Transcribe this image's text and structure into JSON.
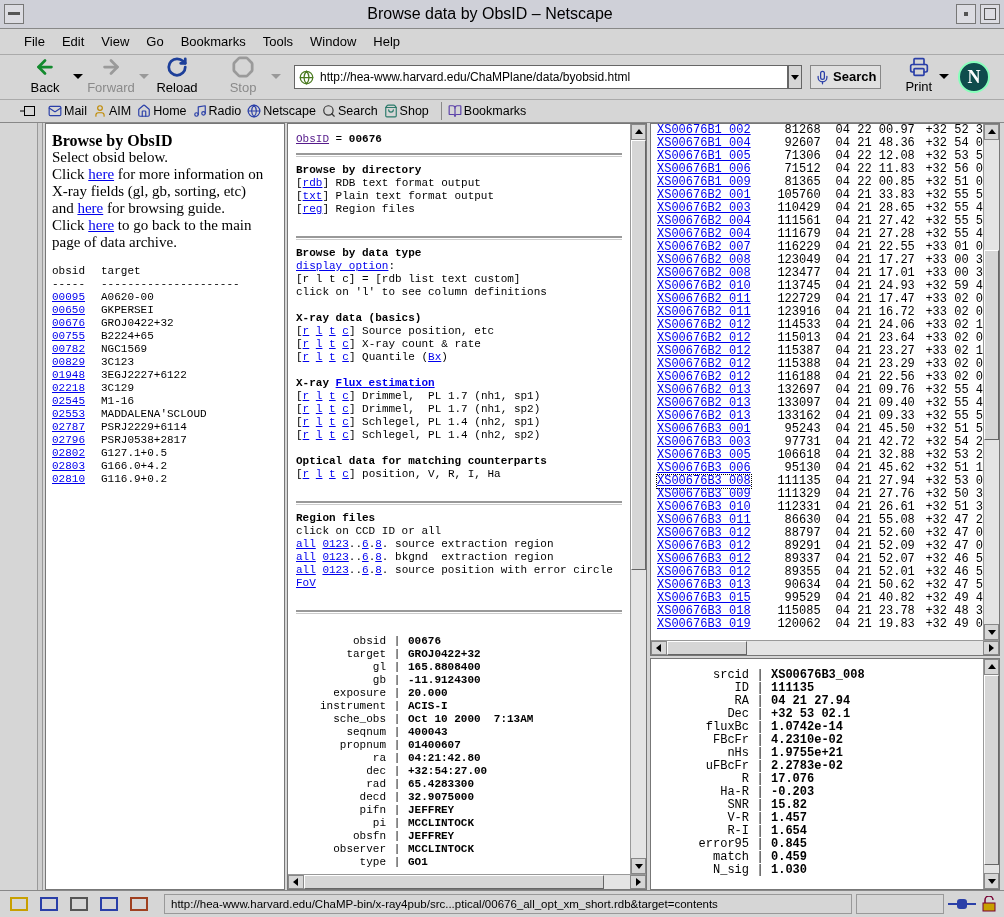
{
  "window": {
    "title": "Browse data by ObsID – Netscape"
  },
  "menu": [
    "File",
    "Edit",
    "View",
    "Go",
    "Bookmarks",
    "Tools",
    "Window",
    "Help"
  ],
  "nav_toolbar": {
    "buttons": [
      {
        "label": "Back",
        "kind": "back",
        "disabled": false,
        "dropdown": true
      },
      {
        "label": "Forward",
        "kind": "forward",
        "disabled": true,
        "dropdown": true
      },
      {
        "label": "Reload",
        "kind": "reload",
        "disabled": false,
        "dropdown": false
      },
      {
        "label": "Stop",
        "kind": "stop",
        "disabled": true,
        "dropdown": true
      }
    ],
    "url": "http://hea-www.harvard.edu/ChaMPlane/data/byobsid.html",
    "search": "Search",
    "print": "Print",
    "logo_letter": "N"
  },
  "personal_toolbar": [
    {
      "label": "Mail",
      "kind": "mail"
    },
    {
      "label": "AIM",
      "kind": "aim"
    },
    {
      "label": "Home",
      "kind": "home"
    },
    {
      "label": "Radio",
      "kind": "radio"
    },
    {
      "label": "Netscape",
      "kind": "netscape"
    },
    {
      "label": "Search",
      "kind": "search"
    },
    {
      "label": "Shop",
      "kind": "shop"
    },
    {
      "label": "Bookmarks",
      "kind": "bookmarks"
    }
  ],
  "left_frame": {
    "heading": "Browse by ObsID",
    "paragraphs": [
      [
        {
          "t": "Select obsid below."
        }
      ],
      [
        {
          "t": "Click "
        },
        {
          "t": "here",
          "link": true
        },
        {
          "t": " for more information on X-ray fields (gl, gb, sorting, etc) and "
        },
        {
          "t": "here",
          "link": true
        },
        {
          "t": " for browsing guide."
        }
      ],
      [
        {
          "t": "Click "
        },
        {
          "t": "here",
          "link": true
        },
        {
          "t": " to go back to the main page of data archive."
        }
      ]
    ],
    "table": {
      "columns": [
        "obsid",
        "target"
      ],
      "rules": [
        "-----",
        "---------------------"
      ],
      "rows": [
        {
          "obsid": "00095",
          "target": "A0620-00"
        },
        {
          "obsid": "00650",
          "target": "GKPERSEI"
        },
        {
          "obsid": "00676",
          "target": "GROJ0422+32"
        },
        {
          "obsid": "00755",
          "target": "B2224+65"
        },
        {
          "obsid": "00782",
          "target": "NGC1569"
        },
        {
          "obsid": "00829",
          "target": "3C123"
        },
        {
          "obsid": "01948",
          "target": "3EGJ2227+6122"
        },
        {
          "obsid": "02218",
          "target": "3C129"
        },
        {
          "obsid": "02545",
          "target": "M1-16"
        },
        {
          "obsid": "02553",
          "target": "MADDALENA'SCLOUD"
        },
        {
          "obsid": "02787",
          "target": "PSRJ2229+6114"
        },
        {
          "obsid": "02796",
          "target": "PSRJ0538+2817"
        },
        {
          "obsid": "02802",
          "target": "G127.1+0.5"
        },
        {
          "obsid": "02803",
          "target": "G166.0+4.2"
        },
        {
          "obsid": "02810",
          "target": "G116.9+0.2"
        }
      ]
    }
  },
  "middle_frame": {
    "top": [
      {
        "t": "ObsID",
        "link": true,
        "visited": true
      },
      {
        "t": " = "
      },
      {
        "t": "00676",
        "bold": true
      }
    ],
    "groups": [
      {
        "sections": [
          {
            "heading": [
              {
                "t": "Browse by directory"
              }
            ],
            "lines": [
              [
                {
                  "t": "["
                },
                {
                  "t": "rdb",
                  "link": true
                },
                {
                  "t": "] RDB text format output"
                }
              ],
              [
                {
                  "t": "["
                },
                {
                  "t": "txt",
                  "link": true
                },
                {
                  "t": "] Plain text format output"
                }
              ],
              [
                {
                  "t": "["
                },
                {
                  "t": "reg",
                  "link": true
                },
                {
                  "t": "] Region files"
                }
              ]
            ]
          }
        ]
      },
      {
        "sections": [
          {
            "heading": [
              {
                "t": "Browse by data type"
              }
            ],
            "lines": [
              [
                {
                  "t": "display option",
                  "link": true
                },
                {
                  "t": ":"
                }
              ],
              [
                {
                  "t": "[r l t c] = [rdb list text custom]"
                }
              ],
              [
                {
                  "t": "click on 'l' to see column definitions"
                }
              ]
            ]
          },
          {
            "heading": [
              {
                "t": "X-ray data (basics)"
              }
            ],
            "lines": [
              [
                {
                  "t": "["
                },
                {
                  "t": "r",
                  "link": true
                },
                {
                  "t": "l",
                  "link": true
                },
                {
                  "t": "t",
                  "link": true
                },
                {
                  "t": "c",
                  "link": true
                },
                {
                  "t": "] Source position, etc"
                }
              ],
              [
                {
                  "t": "["
                },
                {
                  "t": "r",
                  "link": true
                },
                {
                  "t": "l",
                  "link": true
                },
                {
                  "t": "t",
                  "link": true
                },
                {
                  "t": "c",
                  "link": true
                },
                {
                  "t": "] X-ray count & rate"
                }
              ],
              [
                {
                  "t": "["
                },
                {
                  "t": "r",
                  "link": true
                },
                {
                  "t": "l",
                  "link": true
                },
                {
                  "t": "t",
                  "link": true
                },
                {
                  "t": "c",
                  "link": true
                },
                {
                  "t": "] Quantile ("
                },
                {
                  "t": "Bx",
                  "link": true
                },
                {
                  "t": ")"
                }
              ]
            ]
          },
          {
            "heading": [
              {
                "t": "X-ray "
              },
              {
                "t": "Flux estimation",
                "link": true
              }
            ],
            "lines": [
              [
                {
                  "t": "["
                },
                {
                  "t": "r",
                  "link": true
                },
                {
                  "t": "l",
                  "link": true
                },
                {
                  "t": "t",
                  "link": true
                },
                {
                  "t": "c",
                  "link": true
                },
                {
                  "t": "] Drimmel,  PL 1.7 (nh1, sp1)"
                }
              ],
              [
                {
                  "t": "["
                },
                {
                  "t": "r",
                  "link": true
                },
                {
                  "t": "l",
                  "link": true
                },
                {
                  "t": "t",
                  "link": true
                },
                {
                  "t": "c",
                  "link": true
                },
                {
                  "t": "] Drimmel,  PL 1.7 (nh1, sp2)"
                }
              ],
              [
                {
                  "t": "["
                },
                {
                  "t": "r",
                  "link": true
                },
                {
                  "t": "l",
                  "link": true
                },
                {
                  "t": "t",
                  "link": true
                },
                {
                  "t": "c",
                  "link": true
                },
                {
                  "t": "] Schlegel, PL 1.4 (nh2, sp1)"
                }
              ],
              [
                {
                  "t": "["
                },
                {
                  "t": "r",
                  "link": true
                },
                {
                  "t": "l",
                  "link": true
                },
                {
                  "t": "t",
                  "link": true
                },
                {
                  "t": "c",
                  "link": true
                },
                {
                  "t": "] Schlegel, PL 1.4 (nh2, sp2)"
                }
              ]
            ]
          },
          {
            "heading": [
              {
                "t": "Optical data for matching counterparts"
              }
            ],
            "lines": [
              [
                {
                  "t": "["
                },
                {
                  "t": "r",
                  "link": true
                },
                {
                  "t": "l",
                  "link": true
                },
                {
                  "t": "t",
                  "link": true
                },
                {
                  "t": "c",
                  "link": true
                },
                {
                  "t": "] position, V, R, I, Ha"
                }
              ]
            ]
          }
        ]
      },
      {
        "sections": [
          {
            "heading": [
              {
                "t": "Region files"
              }
            ],
            "lines": [
              [
                {
                  "t": "click on CCD ID or all"
                }
              ],
              [
                {
                  "t": "all",
                  "link": true
                },
                {
                  "t": "0123",
                  "link": true
                },
                {
                  "t": ".."
                },
                {
                  "t": "6",
                  "link": true
                },
                {
                  "t": "."
                },
                {
                  "t": "8",
                  "link": true
                },
                {
                  "t": ". source extraction region"
                }
              ],
              [
                {
                  "t": "all",
                  "link": true
                },
                {
                  "t": "0123",
                  "link": true
                },
                {
                  "t": ".."
                },
                {
                  "t": "6",
                  "link": true
                },
                {
                  "t": "."
                },
                {
                  "t": "8",
                  "link": true
                },
                {
                  "t": ". bkgnd  extraction region"
                }
              ],
              [
                {
                  "t": "all",
                  "link": true
                },
                {
                  "t": "0123",
                  "link": true
                },
                {
                  "t": ".."
                },
                {
                  "t": "6",
                  "link": true
                },
                {
                  "t": "."
                },
                {
                  "t": "8",
                  "link": true
                },
                {
                  "t": ". source position with error circle"
                }
              ],
              [
                {
                  "t": "FoV",
                  "link": true
                }
              ]
            ]
          }
        ]
      }
    ],
    "info": [
      {
        "label": "obsid",
        "value": "00676"
      },
      {
        "label": "target",
        "value": "GROJ0422+32"
      },
      {
        "label": "gl",
        "value": "165.8808400"
      },
      {
        "label": "gb",
        "value": "-11.9124300"
      },
      {
        "label": "exposure",
        "value": "20.000"
      },
      {
        "label": "instrument",
        "value": "ACIS-I"
      },
      {
        "label": "sche_obs",
        "value": "Oct 10 2000  7:13AM"
      },
      {
        "label": "seqnum",
        "value": "400043"
      },
      {
        "label": "propnum",
        "value": "01400607"
      },
      {
        "label": "ra",
        "value": "04:21:42.80"
      },
      {
        "label": "dec",
        "value": "+32:54:27.00"
      },
      {
        "label": "rad",
        "value": "65.4283300"
      },
      {
        "label": "decd",
        "value": "32.9075000"
      },
      {
        "label": "pifn",
        "value": "JEFFREY"
      },
      {
        "label": "pi",
        "value": "MCCLINTOCK"
      },
      {
        "label": "obsfn",
        "value": "JEFFREY"
      },
      {
        "label": "observer",
        "value": "MCCLINTOCK"
      },
      {
        "label": "type",
        "value": "GO1"
      }
    ],
    "separator": "|"
  },
  "sources_frame": {
    "rows": [
      {
        "srcid": "XS00676B1_002",
        "id": "81268",
        "ra": "04 22 00.97",
        "dec": "+32 52 3",
        "focused": false
      },
      {
        "srcid": "XS00676B1_004",
        "id": "92607",
        "ra": "04 21 48.36",
        "dec": "+32 54 0",
        "focused": false
      },
      {
        "srcid": "XS00676B1_005",
        "id": "71306",
        "ra": "04 22 12.08",
        "dec": "+32 53 5",
        "focused": false
      },
      {
        "srcid": "XS00676B1_006",
        "id": "71512",
        "ra": "04 22 11.83",
        "dec": "+32 56 0",
        "focused": false
      },
      {
        "srcid": "XS00676B1_009",
        "id": "81365",
        "ra": "04 22 00.85",
        "dec": "+32 51 0",
        "focused": false
      },
      {
        "srcid": "XS00676B2_001",
        "id": "105760",
        "ra": "04 21 33.83",
        "dec": "+32 55 5",
        "focused": false
      },
      {
        "srcid": "XS00676B2_003",
        "id": "110429",
        "ra": "04 21 28.65",
        "dec": "+32 55 4",
        "focused": false
      },
      {
        "srcid": "XS00676B2_004",
        "id": "111561",
        "ra": "04 21 27.42",
        "dec": "+32 55 5",
        "focused": false
      },
      {
        "srcid": "XS00676B2_004",
        "id": "111679",
        "ra": "04 21 27.28",
        "dec": "+32 55 4",
        "focused": false
      },
      {
        "srcid": "XS00676B2_007",
        "id": "116229",
        "ra": "04 21 22.55",
        "dec": "+33 01 0",
        "focused": false
      },
      {
        "srcid": "XS00676B2_008",
        "id": "123049",
        "ra": "04 21 17.27",
        "dec": "+33 00 3",
        "focused": false
      },
      {
        "srcid": "XS00676B2_008",
        "id": "123477",
        "ra": "04 21 17.01",
        "dec": "+33 00 3",
        "focused": false
      },
      {
        "srcid": "XS00676B2_010",
        "id": "113745",
        "ra": "04 21 24.93",
        "dec": "+32 59 4",
        "focused": false
      },
      {
        "srcid": "XS00676B2_011",
        "id": "122729",
        "ra": "04 21 17.47",
        "dec": "+33 02 0",
        "focused": false
      },
      {
        "srcid": "XS00676B2_011",
        "id": "123916",
        "ra": "04 21 16.72",
        "dec": "+33 02 0",
        "focused": false
      },
      {
        "srcid": "XS00676B2_012",
        "id": "114533",
        "ra": "04 21 24.06",
        "dec": "+33 02 1",
        "focused": false
      },
      {
        "srcid": "XS00676B2_012",
        "id": "115013",
        "ra": "04 21 23.64",
        "dec": "+33 02 0",
        "focused": false
      },
      {
        "srcid": "XS00676B2_012",
        "id": "115387",
        "ra": "04 21 23.27",
        "dec": "+33 02 1",
        "focused": false
      },
      {
        "srcid": "XS00676B2_012",
        "id": "115388",
        "ra": "04 21 23.29",
        "dec": "+33 02 0",
        "focused": false
      },
      {
        "srcid": "XS00676B2_012",
        "id": "116188",
        "ra": "04 21 22.56",
        "dec": "+33 02 0",
        "focused": false
      },
      {
        "srcid": "XS00676B2_013",
        "id": "132697",
        "ra": "04 21 09.76",
        "dec": "+32 55 4",
        "focused": false
      },
      {
        "srcid": "XS00676B2_013",
        "id": "133097",
        "ra": "04 21 09.40",
        "dec": "+32 55 4",
        "focused": false
      },
      {
        "srcid": "XS00676B2_013",
        "id": "133162",
        "ra": "04 21 09.33",
        "dec": "+32 55 5",
        "focused": false
      },
      {
        "srcid": "XS00676B3_001",
        "id": "95243",
        "ra": "04 21 45.50",
        "dec": "+32 51 5",
        "focused": false
      },
      {
        "srcid": "XS00676B3_003",
        "id": "97731",
        "ra": "04 21 42.72",
        "dec": "+32 54 2",
        "focused": false
      },
      {
        "srcid": "XS00676B3_005",
        "id": "106618",
        "ra": "04 21 32.88",
        "dec": "+32 53 2",
        "focused": false
      },
      {
        "srcid": "XS00676B3_006",
        "id": "95130",
        "ra": "04 21 45.62",
        "dec": "+32 51 1",
        "focused": false
      },
      {
        "srcid": "XS00676B3_008",
        "id": "111135",
        "ra": "04 21 27.94",
        "dec": "+32 53 0",
        "focused": true
      },
      {
        "srcid": "XS00676B3_009",
        "id": "111329",
        "ra": "04 21 27.76",
        "dec": "+32 50 3",
        "focused": false
      },
      {
        "srcid": "XS00676B3_010",
        "id": "112331",
        "ra": "04 21 26.61",
        "dec": "+32 51 3",
        "focused": false
      },
      {
        "srcid": "XS00676B3_011",
        "id": "86630",
        "ra": "04 21 55.08",
        "dec": "+32 47 2",
        "focused": false
      },
      {
        "srcid": "XS00676B3_012",
        "id": "88797",
        "ra": "04 21 52.60",
        "dec": "+32 47 0",
        "focused": false
      },
      {
        "srcid": "XS00676B3_012",
        "id": "89291",
        "ra": "04 21 52.09",
        "dec": "+32 47 0",
        "focused": false
      },
      {
        "srcid": "XS00676B3_012",
        "id": "89337",
        "ra": "04 21 52.07",
        "dec": "+32 46 5",
        "focused": false
      },
      {
        "srcid": "XS00676B3_012",
        "id": "89355",
        "ra": "04 21 52.01",
        "dec": "+32 46 5",
        "focused": false
      },
      {
        "srcid": "XS00676B3_013",
        "id": "90634",
        "ra": "04 21 50.62",
        "dec": "+32 47 5",
        "focused": false
      },
      {
        "srcid": "XS00676B3_015",
        "id": "99529",
        "ra": "04 21 40.82",
        "dec": "+32 49 4",
        "focused": false
      },
      {
        "srcid": "XS00676B3_018",
        "id": "115085",
        "ra": "04 21 23.78",
        "dec": "+32 48 3",
        "focused": false
      },
      {
        "srcid": "XS00676B3_019",
        "id": "120062",
        "ra": "04 21 19.83",
        "dec": "+32 49 0",
        "focused": false
      }
    ]
  },
  "detail_frame": {
    "info": [
      {
        "label": "srcid",
        "value": "XS00676B3_008"
      },
      {
        "label": "ID",
        "value": "111135"
      },
      {
        "label": "RA",
        "value": "04 21 27.94"
      },
      {
        "label": "Dec",
        "value": "+32 53 02.1"
      },
      {
        "label": "fluxBc",
        "value": "1.0742e-14"
      },
      {
        "label": "FBcFr",
        "value": "4.2310e-02"
      },
      {
        "label": "nHs",
        "value": "1.9755e+21"
      },
      {
        "label": "uFBcFr",
        "value": "2.2783e-02"
      },
      {
        "label": "R",
        "value": "17.076"
      },
      {
        "label": "Ha-R",
        "value": "-0.203"
      },
      {
        "label": "SNR",
        "value": "15.82"
      },
      {
        "label": "V-R",
        "value": "1.457"
      },
      {
        "label": "R-I",
        "value": "1.654"
      },
      {
        "label": "error95",
        "value": "0.845"
      },
      {
        "label": "match",
        "value": "0.459"
      },
      {
        "label": "N_sig",
        "value": "1.030"
      }
    ],
    "separator": "|"
  },
  "status_bar": {
    "text": "http://hea-www.harvard.edu/ChaMP-bin/x-ray4pub/src...ptical/00676_all_opt_xm_short.rdb&target=contents"
  }
}
